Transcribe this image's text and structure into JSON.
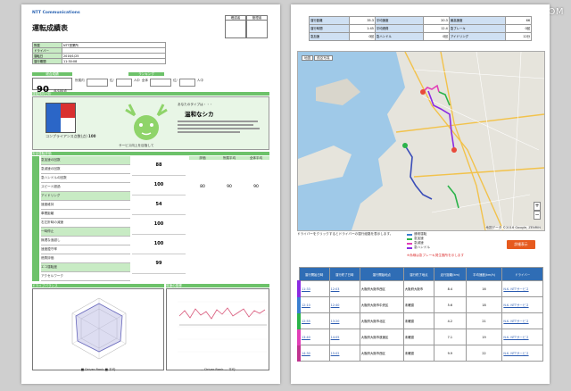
{
  "watermark": "RBBTODAY.COM",
  "left": {
    "logo": "NTT Communications",
    "title": "運転成績表",
    "stamps": [
      "確認者",
      "管理者"
    ],
    "info_rows": [
      [
        "所属",
        "NTT営業所"
      ],
      [
        "ドライバー",
        ""
      ],
      [
        "運転日",
        "2016/1/25"
      ],
      [
        "運行期間",
        "11:30:08"
      ]
    ],
    "score_label": "総合成績",
    "score_value": "90",
    "score_unit": "点/100点",
    "rank_label": "ランキング",
    "rank_parts": [
      "所属内",
      "位/",
      "人中",
      "全体",
      "位/",
      "人中"
    ],
    "section_type": "運転傾向分析",
    "compliance_label": "コンプライアンス点数(点)",
    "compliance_value": "100",
    "driver_type_prefix": "あなたのタイプは・・・",
    "driver_type": "温和なシカ",
    "advice_title": "サービス向上を目指して",
    "section_detail": "安全運転評価",
    "col_heads": [
      "評価",
      "所属平均",
      "全体平均"
    ],
    "detail_rows": [
      "急加速の回数",
      "急減速の回数",
      "急ハンドルの回数",
      "スピード超過",
      "アイドリング",
      "速度維持",
      "車間距離",
      "右左折時の減速",
      "一時停止",
      "無理な追越し",
      "速度遵守率",
      "燃費評価",
      "エコ運転度",
      "アクセルワーク"
    ],
    "detail_scores": [
      "88",
      "100",
      "54",
      "100",
      "100",
      "99"
    ],
    "avg_scores": [
      "80",
      "90",
      "90"
    ],
    "footer_left": "ドライブバランス",
    "footer_right": "時速の推移",
    "legend_left": "■ Driver Rank ■ 平均",
    "legend_right": "— Driver Rank — 平均"
  },
  "right": {
    "summary": [
      [
        "運行距離",
        "35.3",
        "平均速度",
        "20.3",
        "最高速度",
        "66"
      ],
      [
        "運行時間",
        "1:45",
        "平均燃費",
        "12.4",
        "急ブレーキ",
        "0回"
      ],
      [
        "急加速",
        "0回",
        "急ハンドル",
        "0回",
        "アイドリング",
        "12分"
      ]
    ],
    "map_tabs": [
      "地図",
      "航空写真"
    ],
    "map_copyright": "地図データ ©2016 Google, ZENRIN",
    "map_note": "ドライバーをクリックするとドライバーの運行経路を表示します。",
    "map_legend": [
      "通常運転",
      "急加速",
      "急減速",
      "急ハンドル"
    ],
    "warn_note": "※赤線は急ブレーキ発生箇所を示します",
    "map_button": "詳細表示",
    "route_headers": [
      "運行開始日時",
      "運行終了日時",
      "運行開始地点",
      "運行終了地点",
      "走行距離(km)",
      "平均速度(km/h)",
      "ドライバー"
    ],
    "routes": [
      {
        "color": "#8a2be2",
        "start": "11:33",
        "end": "12:03",
        "from": "大阪府大阪市西区",
        "to": "大阪府大阪市",
        "km": "8.4",
        "speed": "16",
        "driver": "N.K. NTTサービス"
      },
      {
        "color": "#3a7fd0",
        "start": "12:10",
        "end": "12:40",
        "from": "大阪府大阪市中央区",
        "to": "未確認",
        "km": "5.6",
        "speed": "18",
        "driver": "N.K. NTTサービス"
      },
      {
        "color": "#2bb34a",
        "start": "12:55",
        "end": "13:20",
        "from": "大阪府大阪市北区",
        "to": "未確認",
        "km": "4.2",
        "speed": "21",
        "driver": "N.K. NTTサービス"
      },
      {
        "color": "#e23fb7",
        "start": "13:40",
        "end": "14:05",
        "from": "大阪府大阪市浪速区",
        "to": "未確認",
        "km": "7.1",
        "speed": "19",
        "driver": "N.K. NTTサービス"
      },
      {
        "color": "#c0338f",
        "start": "14:30",
        "end": "15:02",
        "from": "大阪府大阪市西区",
        "to": "未確認",
        "km": "9.9",
        "speed": "22",
        "driver": "N.K. NTTサービス"
      }
    ]
  }
}
